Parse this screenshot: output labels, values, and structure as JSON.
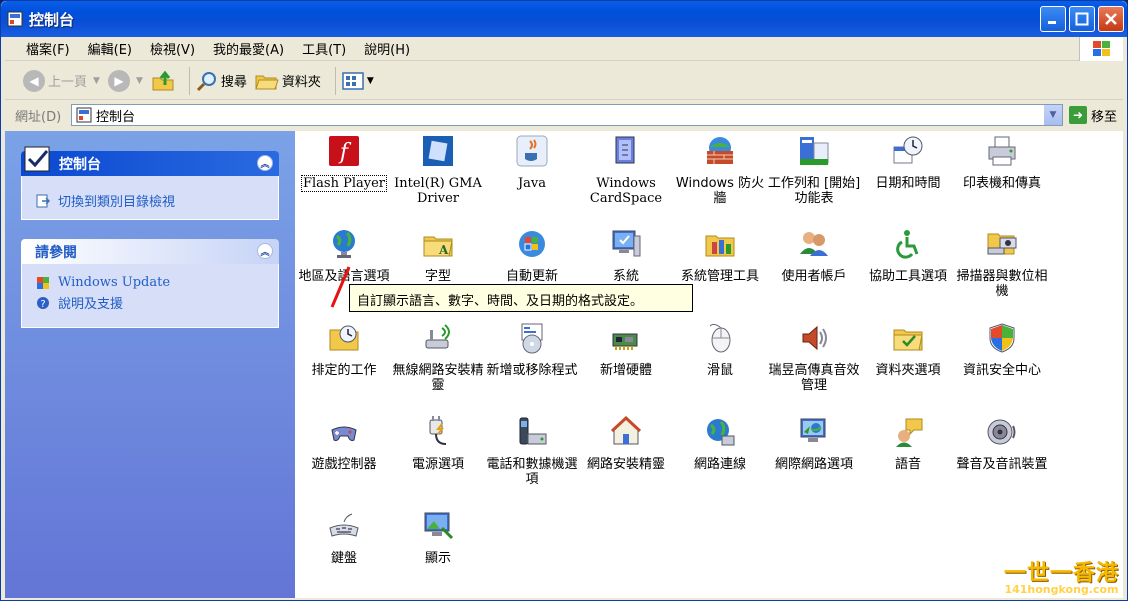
{
  "window": {
    "title": "控制台"
  },
  "menu": [
    "檔案(F)",
    "編輯(E)",
    "檢視(V)",
    "我的最愛(A)",
    "工具(T)",
    "說明(H)"
  ],
  "toolbar": {
    "back": "上一頁",
    "search": "搜尋",
    "folders": "資料夾"
  },
  "address": {
    "label": "網址(D)",
    "value": "控制台",
    "go": "移至"
  },
  "left": {
    "panel1": {
      "title": "控制台",
      "link": "切換到類別目錄檢視"
    },
    "panel2": {
      "title": "請參閱",
      "links": [
        "Windows Update",
        "說明及支援"
      ]
    }
  },
  "items": [
    "Flash Player",
    "Intel(R) GMA Driver",
    "Java",
    "Windows CardSpace",
    "Windows 防火牆",
    "工作列和 [開始] 功能表",
    "日期和時間",
    "印表機和傳真",
    "地區及語言選項",
    "字型",
    "自動更新",
    "系統",
    "系統管理工具",
    "使用者帳戶",
    "協助工具選項",
    "掃描器與數位相機",
    "排定的工作",
    "無線網路安裝精靈",
    "新增或移除程式",
    "新增硬體",
    "滑鼠",
    "瑞昱高傳真音效管理",
    "資料夾選項",
    "資訊安全中心",
    "遊戲控制器",
    "電源選項",
    "電話和數據機選項",
    "網路安裝精靈",
    "網路連線",
    "網際網路選項",
    "語音",
    "聲音及音訊裝置",
    "鍵盤",
    "顯示"
  ],
  "tooltip": "自訂顯示語言、數字、時間、及日期的格式設定。",
  "watermark": {
    "line1": "一世一香港",
    "line2": "141hongkong.com"
  }
}
